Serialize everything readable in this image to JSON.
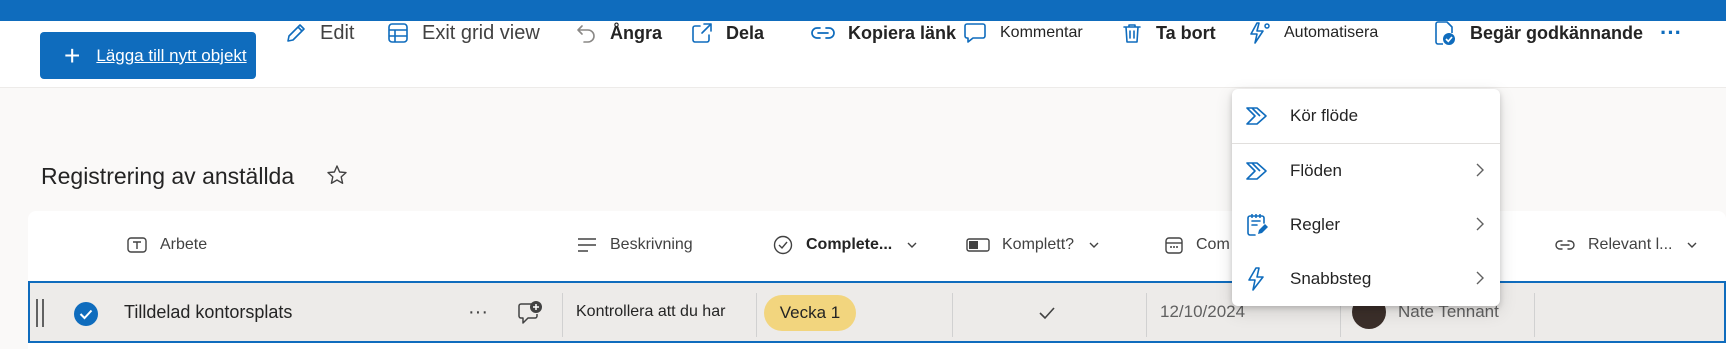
{
  "toolbar": {
    "new_item": "Lägga till nytt objekt",
    "edit": "Edit",
    "exit_grid": "Exit grid view",
    "undo": "Ångra",
    "share": "Dela",
    "copy_link": "Kopiera länk",
    "comment": "Kommentar",
    "delete": "Ta bort",
    "automate": "Automatisera",
    "request_approval": "Begär godkännande",
    "more": "···"
  },
  "list": {
    "title": "Registrering av anställda"
  },
  "columns": {
    "work": "Arbete",
    "description": "Beskrivning",
    "completed": "Complete...",
    "complete_q": "Komplett?",
    "com": "Com",
    "relevant": "Relevant l..."
  },
  "row": {
    "work": "Tilldelad kontorsplats",
    "description": "Kontrollera att du har",
    "week": "Vecka 1",
    "date": "12/10/2024",
    "person": "Nate Tennant"
  },
  "automate_menu": {
    "run_flow": "Kör flöde",
    "flows": "Flöden",
    "rules": "Regler",
    "quick_steps": "Snabbsteg"
  },
  "colors": {
    "accent": "#0f6cbd",
    "pill": "#f2d57e"
  }
}
